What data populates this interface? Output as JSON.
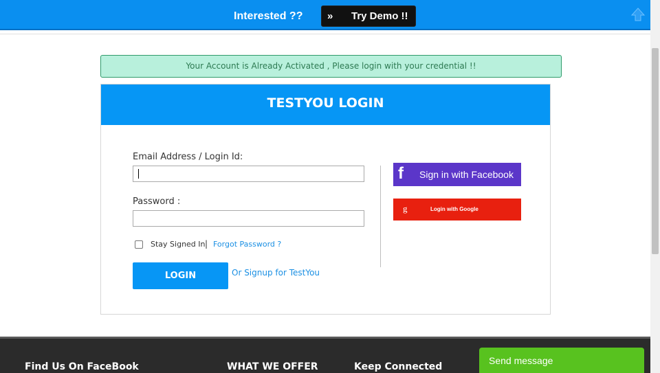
{
  "topbar": {
    "interested": "Interested ??",
    "demo_chevron": "»",
    "demo_label": "Try Demo  !!"
  },
  "alert": {
    "message": "Your Account is Already Activated , Please login with your credential !!"
  },
  "login": {
    "title": "TESTYOU LOGIN",
    "email_label": "Email Address / Login Id:",
    "email_value": "",
    "password_label": "Password :",
    "password_value": "",
    "stay_signed_in": "Stay Signed In",
    "separator": "|",
    "forgot_password": "Forgot Password ?",
    "login_button": "LOGIN",
    "signup_link": "Or Signup for TestYou",
    "facebook_icon": "f",
    "facebook_button": "Sign in with Facebook",
    "google_icon": "g",
    "google_button": "Login with Google"
  },
  "footer": {
    "col1": "Find Us On FaceBook",
    "col2": "WHAT WE OFFER",
    "col3": "Keep Connected",
    "send_message": "Send message"
  },
  "colors": {
    "brand_blue": "#0696f5",
    "alert_bg": "#b8f0dc",
    "facebook": "#5b36c9",
    "google": "#e8200f",
    "chat": "#58c21f"
  }
}
